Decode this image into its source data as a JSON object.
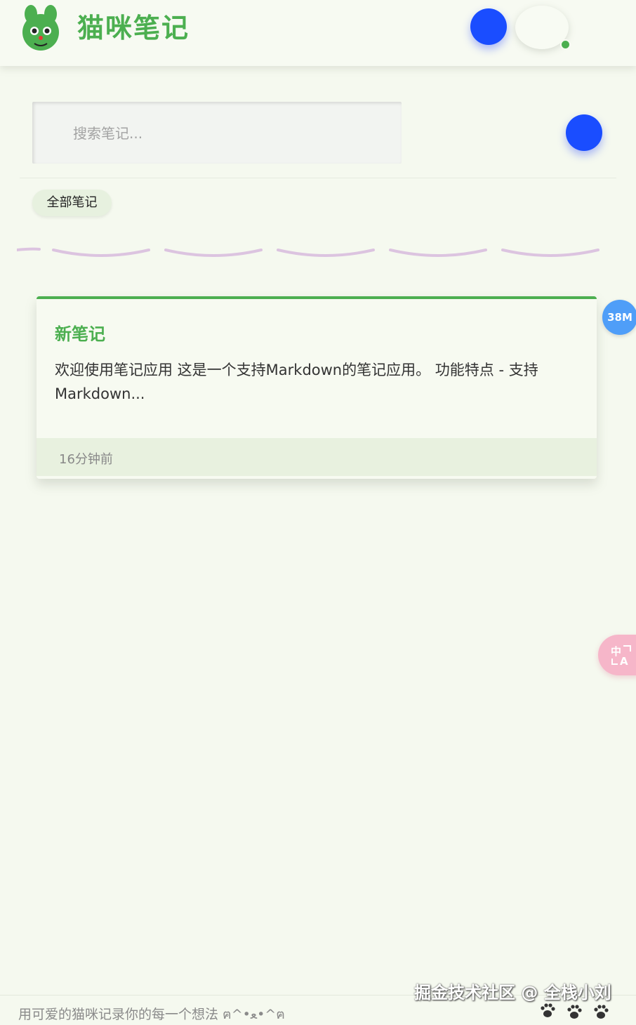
{
  "header": {
    "app_title": "猫咪笔记",
    "logo_icon": "green-cat-face-logo-icon"
  },
  "search": {
    "placeholder": "搜索笔记..."
  },
  "filters": {
    "all_notes_label": "全部笔记"
  },
  "notes": [
    {
      "title": "新笔记",
      "preview": "欢迎使用笔记应用 这是一个支持Markdown的笔记应用。 功能特点 - 支持Markdown...",
      "time": "16分钟前"
    }
  ],
  "floating": {
    "memory_badge": "38M",
    "translate_icon": "translate-icon"
  },
  "footer": {
    "tagline": "用可爱的猫咪记录你的每一个想法 ฅ^•ﻌ•^ฅ"
  },
  "watermark": {
    "text": "掘金技术社区 @ 全栈小刘"
  },
  "colors": {
    "brand_green": "#4caf50",
    "accent_blue": "#1a4dff",
    "background": "#f5f9ef",
    "translate_pink": "#f6b6c9",
    "badge_blue": "#4f9ef8"
  }
}
